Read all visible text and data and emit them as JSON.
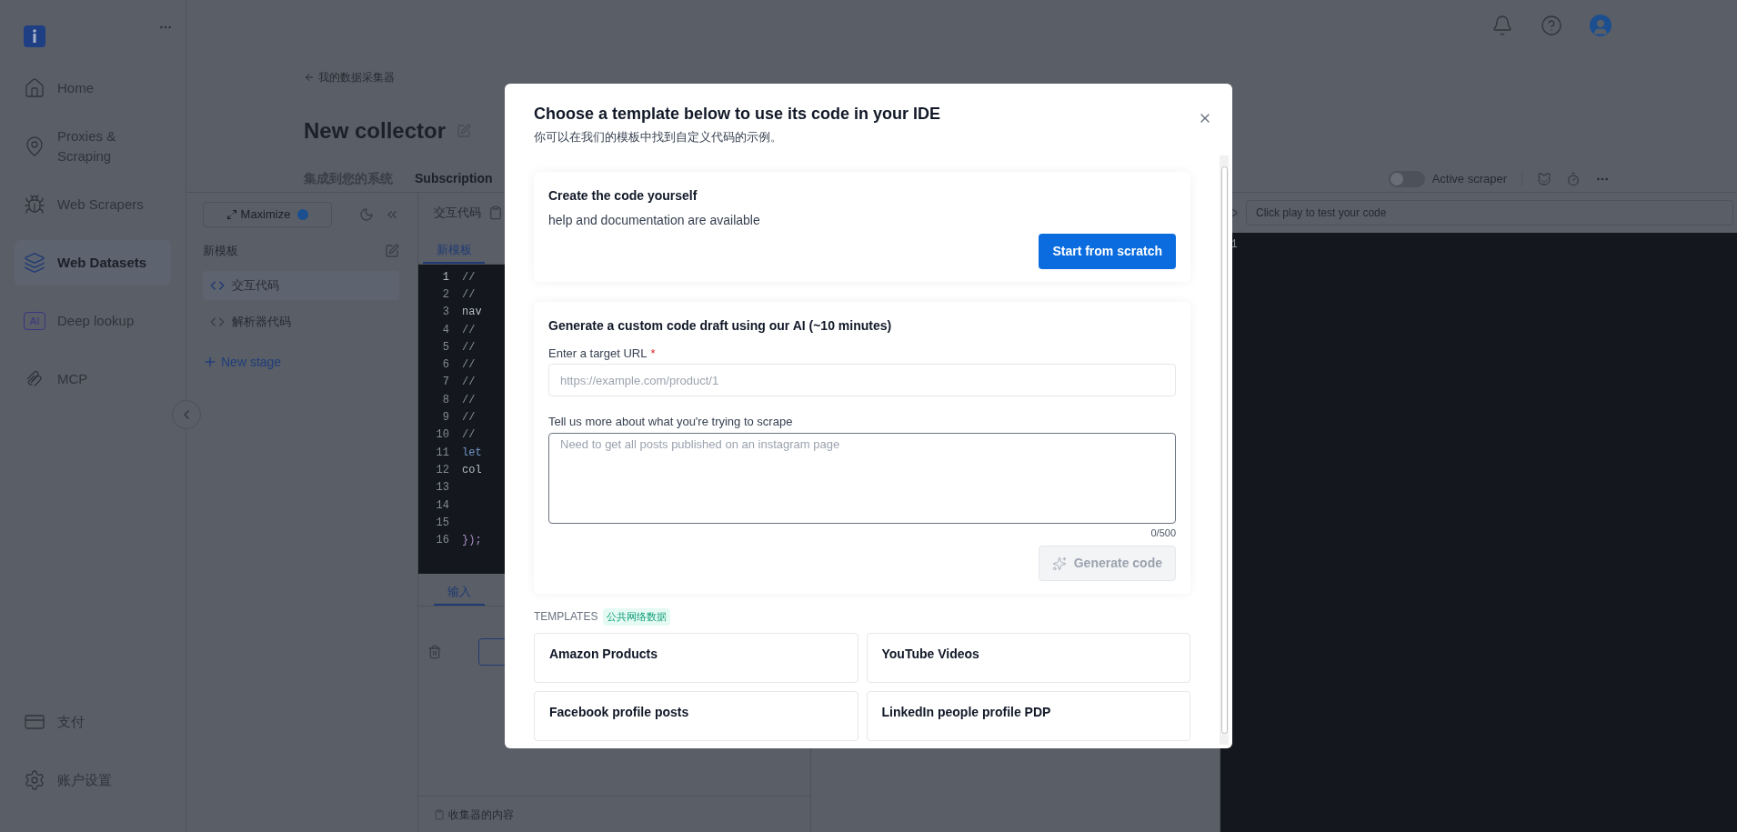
{
  "nav": {
    "items": [
      {
        "label": "Home",
        "selected": false
      },
      {
        "label": "Proxies & Scraping",
        "selected": false
      },
      {
        "label": "Web Scrapers",
        "selected": false
      },
      {
        "label": "Web Datasets",
        "selected": true
      },
      {
        "label": "Deep lookup",
        "selected": false,
        "icon_text": "AI"
      },
      {
        "label": "MCP",
        "selected": false
      }
    ],
    "bottom_items": [
      "支付",
      "账户设置"
    ]
  },
  "header": {
    "breadcrumb": "我的数据采集器",
    "title": "New collector",
    "tabs": [
      {
        "label": "集成到您的系统",
        "selected": false
      },
      {
        "label": "Subscription",
        "selected": true
      }
    ],
    "active_scraper": {
      "label": "Active scraper",
      "on": false
    }
  },
  "stages": {
    "maximize": "Maximize",
    "template_name": "新模板",
    "items": [
      {
        "label": "交互代码",
        "selected": true
      },
      {
        "label": "解析器代码",
        "selected": false
      }
    ],
    "new_stage": "New stage"
  },
  "editor": {
    "title": "交互代码",
    "tab": "新模板",
    "lines": [
      {
        "number": "1",
        "text": "//",
        "kind": "comment"
      },
      {
        "number": "2",
        "text": "//",
        "kind": "comment"
      },
      {
        "number": "3",
        "text": "nav",
        "kind": "plain"
      },
      {
        "number": "4",
        "text": "//",
        "kind": "comment"
      },
      {
        "number": "5",
        "text": "//",
        "kind": "comment"
      },
      {
        "number": "6",
        "text": "//",
        "kind": "comment"
      },
      {
        "number": "7",
        "text": "//",
        "kind": "comment"
      },
      {
        "number": "8",
        "text": "//",
        "kind": "comment"
      },
      {
        "number": "9",
        "text": "//",
        "kind": "comment"
      },
      {
        "number": "10",
        "text": "//",
        "kind": "comment"
      },
      {
        "number": "11",
        "text": "let",
        "kind": "keyword"
      },
      {
        "number": "12",
        "text": "col",
        "kind": "plain"
      },
      {
        "number": "13"
      },
      {
        "number": "14"
      },
      {
        "number": "15"
      },
      {
        "number": "16",
        "text": "});",
        "kind": "brace"
      }
    ],
    "bottom_tab": "输入",
    "footer": "收集器的内容"
  },
  "output": {
    "placeholder": "Click play to test your code",
    "lines": [
      "1"
    ]
  },
  "modal": {
    "title": "Choose a template below to use its code in your IDE",
    "subtitle": "你可以在我们的模板中找到自定义代码的示例。",
    "scratch": {
      "title": "Create the code yourself",
      "text": "help and documentation are available",
      "button": "Start from scratch"
    },
    "ai": {
      "title": "Generate a custom code draft using our AI (~10 minutes)",
      "url_label": "Enter a target URL",
      "required_mark": "*",
      "url_placeholder": "https://example.com/product/1",
      "describe_label": "Tell us more about what you're trying to scrape",
      "describe_placeholder": "Need to get all posts published on an instagram page",
      "counter": "0/500",
      "button": "Generate code",
      "button_disabled": true
    },
    "templates_label": "TEMPLATES",
    "templates_tag": "公共网络数据",
    "templates": [
      "Amazon Products",
      "YouTube Videos",
      "Facebook profile posts",
      "LinkedIn people profile PDP"
    ]
  }
}
